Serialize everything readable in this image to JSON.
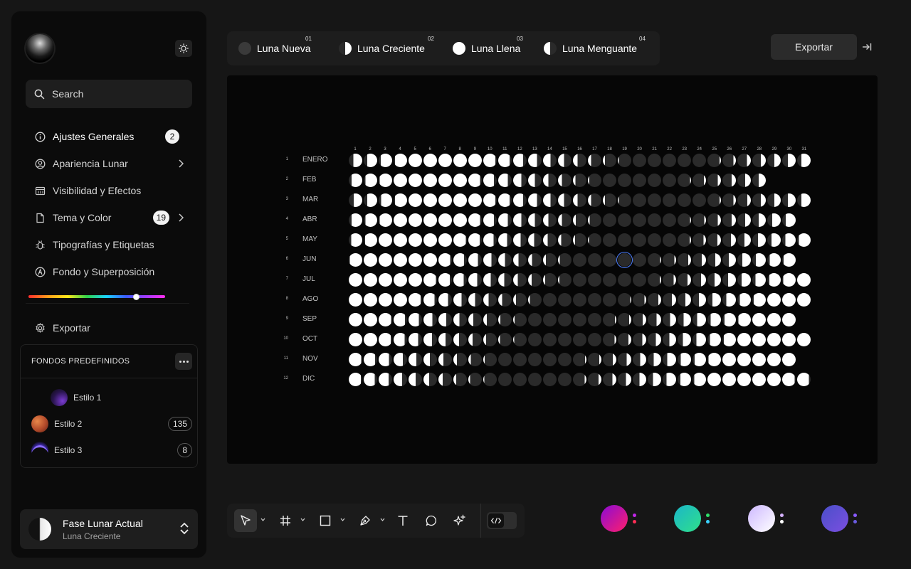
{
  "sidebar": {
    "search_placeholder": "Search",
    "nav": [
      {
        "label": "Ajustes Generales",
        "badge": "2"
      },
      {
        "label": "Apariencia Lunar"
      },
      {
        "label": "Visibilidad y Efectos"
      },
      {
        "label": "Tema y Color",
        "badge": "19"
      },
      {
        "label": "Tipografías y Etiquetas"
      },
      {
        "label": "Fondo y Superposición"
      }
    ],
    "hue_slider_value": 0.79,
    "export_label": "Exportar",
    "presets": {
      "title": "FONDOS PREDEFINIDOS",
      "items": [
        {
          "label": "Estilo 1",
          "count": ""
        },
        {
          "label": "Estilo 2",
          "count": "135"
        },
        {
          "label": "Estilo 3",
          "count": "8"
        }
      ]
    },
    "current_phase": {
      "title": "Fase Lunar Actual",
      "subtitle": "Luna Creciente"
    }
  },
  "phase_tabs": [
    {
      "num": "01",
      "label": "Luna Nueva"
    },
    {
      "num": "02",
      "label": "Luna Creciente"
    },
    {
      "num": "03",
      "label": "Luna Llena"
    },
    {
      "num": "04",
      "label": "Luna Menguante"
    }
  ],
  "export_button": "Exportar",
  "calendar": {
    "days": [
      "1",
      "2",
      "3",
      "4",
      "5",
      "6",
      "7",
      "8",
      "9",
      "10",
      "11",
      "12",
      "13",
      "14",
      "15",
      "16",
      "17",
      "18",
      "19",
      "20",
      "21",
      "22",
      "23",
      "24",
      "25",
      "26",
      "27",
      "28",
      "29",
      "30",
      "31"
    ],
    "months": [
      {
        "idx": "1",
        "name": "ENERO",
        "days": 31,
        "offset": 0
      },
      {
        "idx": "2",
        "name": "FEB",
        "days": 28,
        "offset": 31
      },
      {
        "idx": "3",
        "name": "MAR",
        "days": 31,
        "offset": 59
      },
      {
        "idx": "4",
        "name": "ABR",
        "days": 30,
        "offset": 90
      },
      {
        "idx": "5",
        "name": "MAY",
        "days": 31,
        "offset": 120
      },
      {
        "idx": "6",
        "name": "JUN",
        "days": 30,
        "offset": 151
      },
      {
        "idx": "7",
        "name": "JUL",
        "days": 31,
        "offset": 181
      },
      {
        "idx": "8",
        "name": "AGO",
        "days": 31,
        "offset": 212
      },
      {
        "idx": "9",
        "name": "SEP",
        "days": 30,
        "offset": 243
      },
      {
        "idx": "10",
        "name": "OCT",
        "days": 31,
        "offset": 273
      },
      {
        "idx": "11",
        "name": "NOV",
        "days": 30,
        "offset": 304
      },
      {
        "idx": "12",
        "name": "DIC",
        "days": 31,
        "offset": 334
      }
    ],
    "full_moon_day_of_year": 7,
    "synodic_period_days": 29.53,
    "highlighted": {
      "month": 6,
      "day": 19
    }
  },
  "palettes": [
    {
      "colors": [
        "#ff1f6b",
        "#8a0bd6"
      ],
      "dots": [
        "#c126e8",
        "#ff2d55"
      ]
    },
    {
      "colors": [
        "#2fe08a",
        "#1bb6c9"
      ],
      "dots": [
        "#2fe06a",
        "#3cd3ff"
      ]
    },
    {
      "colors": [
        "#ffffff",
        "#cdb8ff"
      ],
      "dots": [
        "#d7b3ff",
        "#ffffff"
      ]
    },
    {
      "colors": [
        "#7b4fe0",
        "#4a4fc9"
      ],
      "dots": [
        "#8a5bff",
        "#6a5bdf"
      ]
    }
  ],
  "colors": {
    "accent_highlight": "#4d7fff",
    "moon_light": "#ffffff",
    "moon_dark": "#2a2a2a"
  }
}
